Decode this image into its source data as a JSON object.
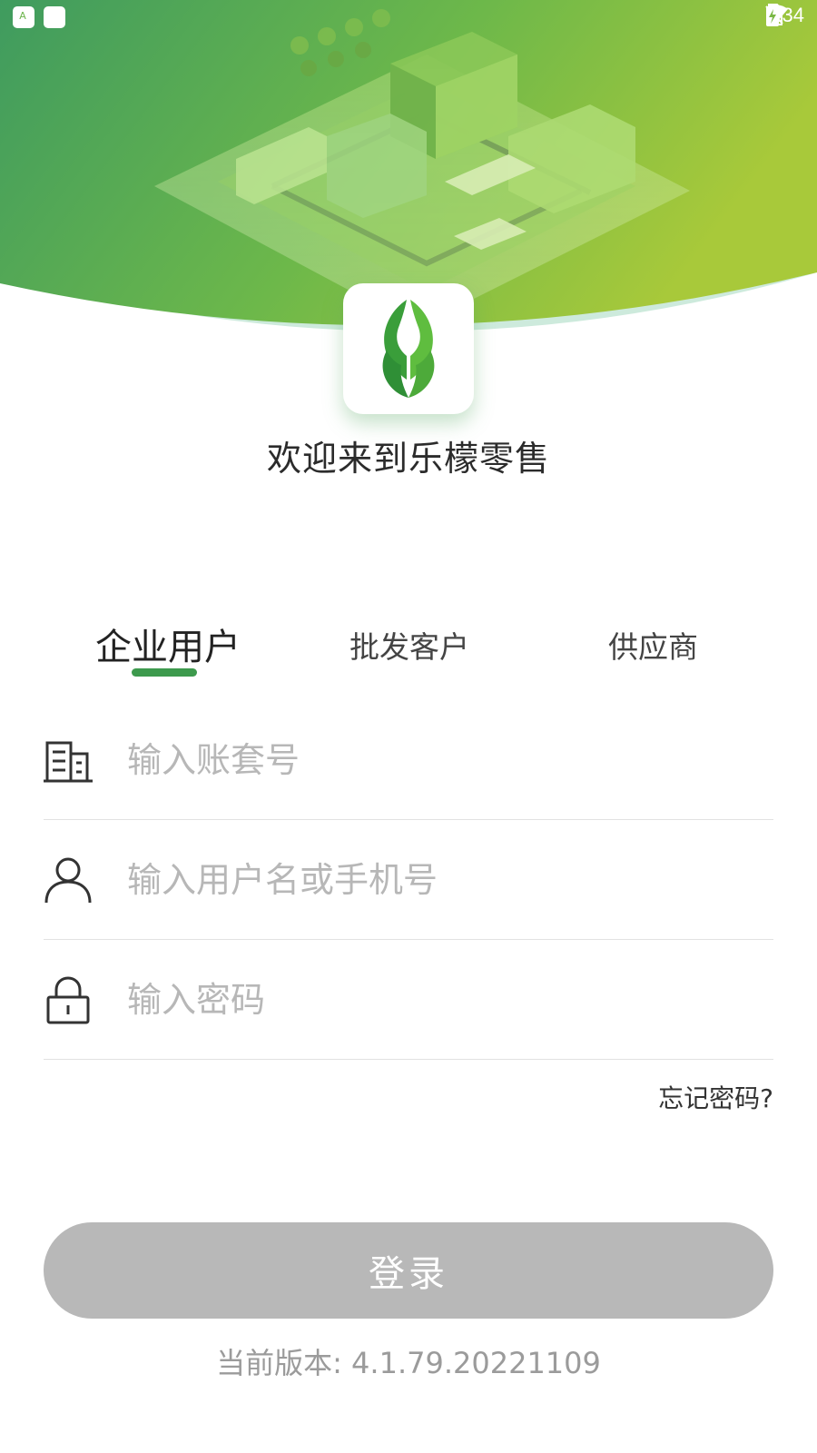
{
  "status_bar": {
    "time": "2:34",
    "icons": [
      "notification-square-icon",
      "notification-square-icon",
      "image-icon",
      "text-icon",
      "wifi-icon",
      "no-sim-icon",
      "battery-charging-icon"
    ]
  },
  "colors": {
    "header_gradient_start": "#3f9b5f",
    "header_gradient_end": "#a8c93a",
    "brand_green": "#3d9a4d",
    "login_disabled": "#b8b8b8"
  },
  "welcome_title": "欢迎来到乐檬零售",
  "tabs": [
    {
      "label": "企业用户",
      "active": true
    },
    {
      "label": "批发客户",
      "active": false
    },
    {
      "label": "供应商",
      "active": false
    }
  ],
  "form": {
    "account_placeholder": "输入账套号",
    "username_placeholder": "输入用户名或手机号",
    "password_placeholder": "输入密码",
    "forgot_label": "忘记密码?",
    "login_label": "登录"
  },
  "version_text": "当前版本: 4.1.79.20221109"
}
